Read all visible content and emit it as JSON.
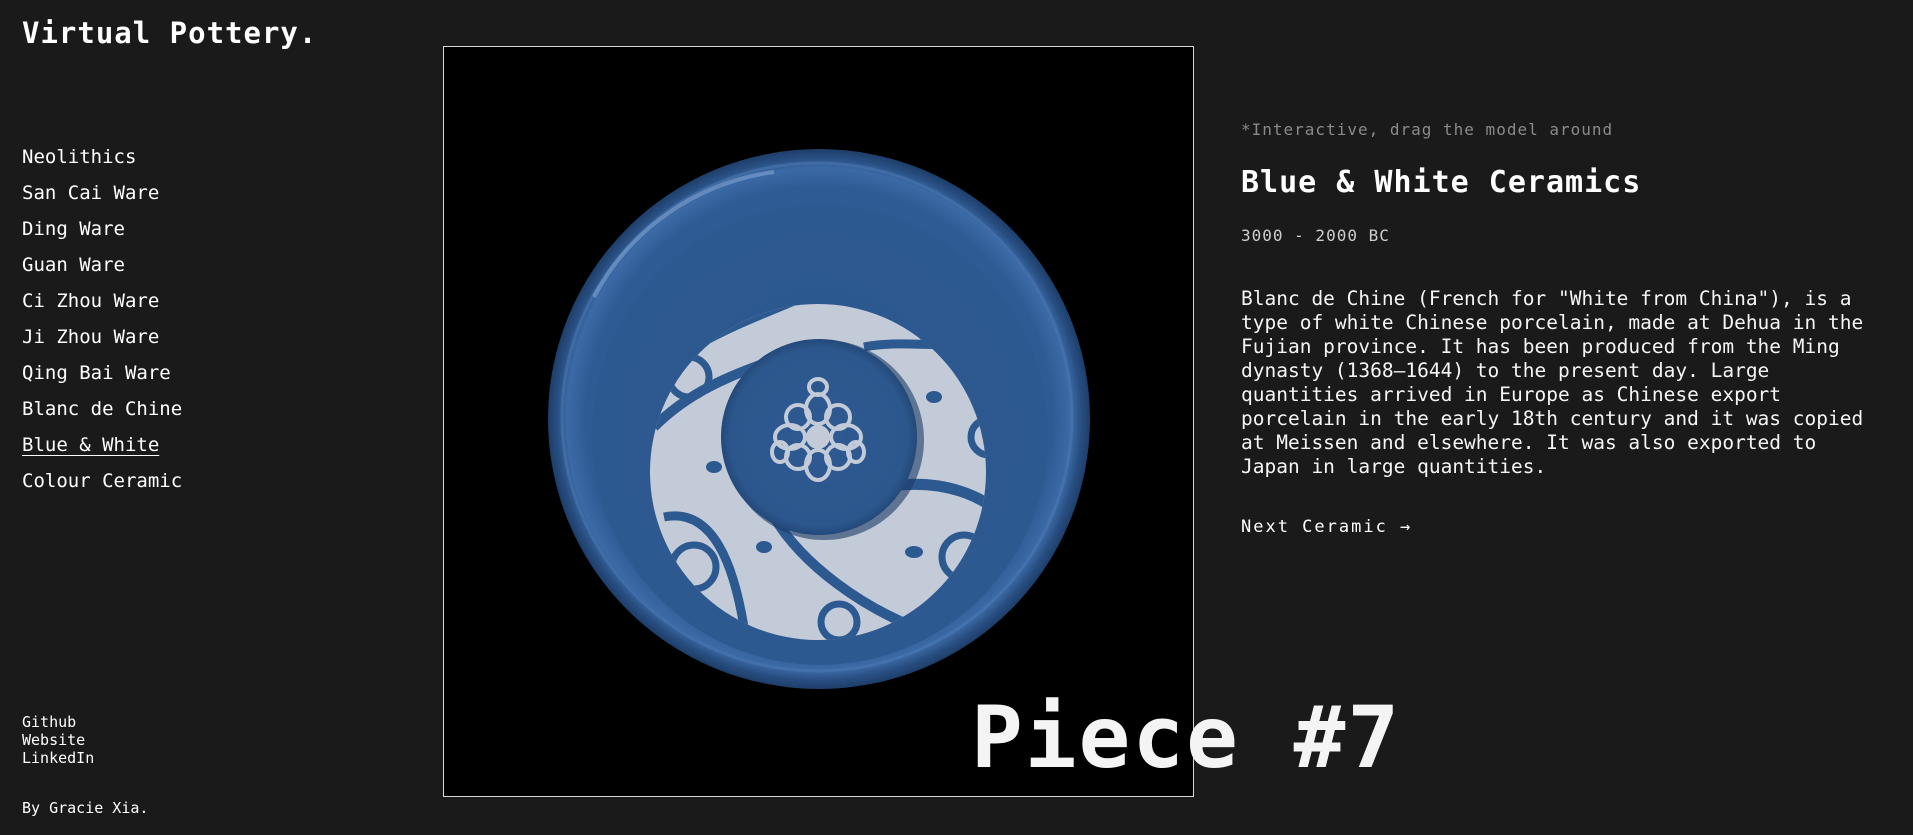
{
  "brand": "Virtual Pottery.",
  "nav": {
    "items": [
      "Neolithics",
      "San Cai Ware",
      "Ding Ware",
      "Guan Ware",
      "Ci Zhou Ware",
      "Ji Zhou Ware",
      "Qing Bai Ware",
      "Blanc de Chine",
      "Blue & White",
      "Colour Ceramic"
    ],
    "active_index": 8
  },
  "links": {
    "github": "Github",
    "website": "Website",
    "linkedin": "LinkedIn"
  },
  "credit": "By Gracie Xia.",
  "viewer": {
    "piece_label": "Piece #7"
  },
  "info": {
    "hint": "*Interactive, drag the model around",
    "title": "Blue & White Ceramics",
    "date": "3000 - 2000 BC",
    "description": "Blanc de Chine (French for \"White from China\"), is a type of white Chinese porcelain, made at Dehua in the Fujian province. It has been produced from the Ming dynasty (1368–1644) to the present day. Large quantities arrived in Europe as Chinese export porcelain in the early 18th century and it was copied at Meissen and elsewhere. It was also exported to Japan in large quantities.",
    "next_label": "Next Ceramic →"
  },
  "colors": {
    "background": "#1a1a1a",
    "plate_blue": "#2e5a93",
    "porcelain_white": "#c3cbd8"
  }
}
